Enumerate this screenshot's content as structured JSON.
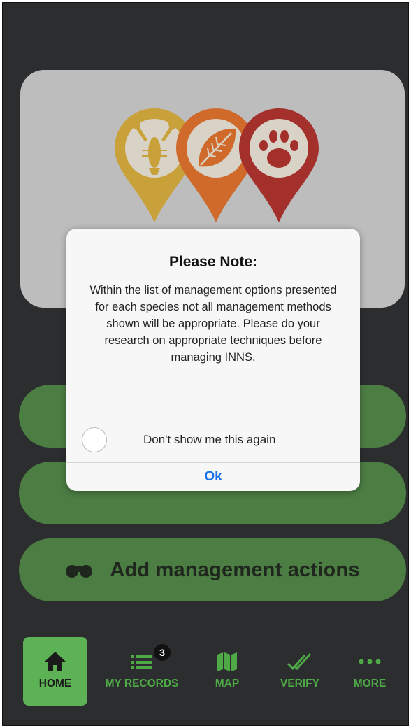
{
  "modal": {
    "title": "Please Note:",
    "body": "Within the list of management options presented for each species not all management methods shown will be appropriate. Please do your research on appropriate techniques before managing INNS.",
    "checkbox_label": "Don't show me this again",
    "checkbox_checked": false,
    "ok_label": "Ok"
  },
  "actions": [
    {
      "label": "",
      "icon": "hidden"
    },
    {
      "label": "",
      "icon": "hidden"
    },
    {
      "label": "Add management actions",
      "icon": "binoculars-icon"
    }
  ],
  "nav": {
    "items": [
      {
        "label": "HOME",
        "icon": "home-icon",
        "active": true
      },
      {
        "label": "MY RECORDS",
        "icon": "list-icon",
        "badge": "3"
      },
      {
        "label": "MAP",
        "icon": "map-icon"
      },
      {
        "label": "VERIFY",
        "icon": "double-check-icon"
      },
      {
        "label": "MORE",
        "icon": "ellipsis-icon"
      }
    ]
  },
  "colors": {
    "background": "#2c2d2f",
    "logo_card": "#bdbdbd",
    "action_button": "#4c7d43",
    "nav_accent": "#5cb254",
    "pin_yellow": "#c9a13a",
    "pin_orange": "#cf6a2b",
    "pin_red": "#a3302a",
    "ok_blue": "#1a73e8"
  }
}
